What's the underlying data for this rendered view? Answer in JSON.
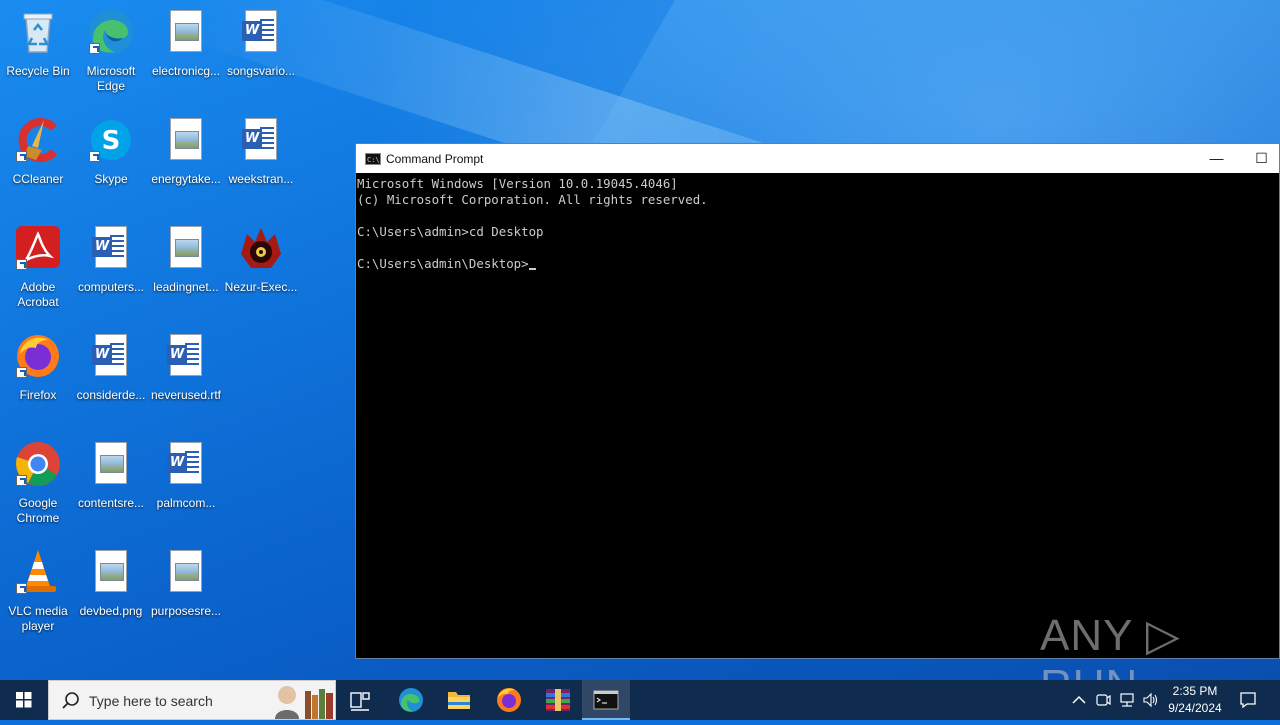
{
  "desktop": {
    "icons": [
      {
        "label": "Recycle Bin"
      },
      {
        "label": "Microsoft Edge"
      },
      {
        "label": "electronicg..."
      },
      {
        "label": "songsvario..."
      },
      {
        "label": "CCleaner"
      },
      {
        "label": "Skype"
      },
      {
        "label": "energytake..."
      },
      {
        "label": "weekstran..."
      },
      {
        "label": "Adobe Acrobat"
      },
      {
        "label": "computers..."
      },
      {
        "label": "leadingnet..."
      },
      {
        "label": "Nezur-Exec..."
      },
      {
        "label": "Firefox"
      },
      {
        "label": "considerde..."
      },
      {
        "label": "neverused.rtf"
      },
      {
        "label": "Google Chrome"
      },
      {
        "label": "contentsre..."
      },
      {
        "label": "palmcom..."
      },
      {
        "label": "VLC media player"
      },
      {
        "label": "devbed.png"
      },
      {
        "label": "purposesre..."
      }
    ]
  },
  "cmd": {
    "title": "Command Prompt",
    "minimize_glyph": "—",
    "maximize_glyph": "☐",
    "lines": [
      "Microsoft Windows [Version 10.0.19045.4046]",
      "(c) Microsoft Corporation. All rights reserved.",
      "",
      "C:\\Users\\admin>cd Desktop",
      "",
      "C:\\Users\\admin\\Desktop>"
    ]
  },
  "watermark": "ANY ▷ RUN",
  "taskbar": {
    "search_placeholder": "Type here to search",
    "time": "2:35 PM",
    "date": "9/24/2024",
    "apps": [
      "task-view",
      "edge",
      "file-explorer",
      "firefox",
      "winrar",
      "command-prompt"
    ],
    "active_app": "command-prompt"
  },
  "colors": {
    "taskbar": "#0f2b4d",
    "cmd_background": "#000000",
    "cmd_text": "#cccccc",
    "desktop_accent": "#0f74dc"
  }
}
